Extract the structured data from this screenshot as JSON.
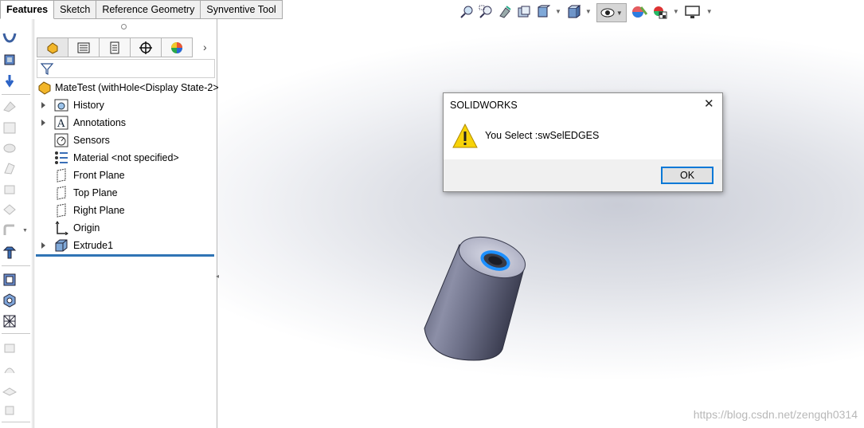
{
  "tabs": [
    "Features",
    "Sketch",
    "Reference Geometry",
    "Synventive Tool"
  ],
  "active_tab": "Features",
  "panel": {
    "tab_icons": [
      "feature-manager-icon",
      "property-manager-icon",
      "configuration-manager-icon",
      "dimxpert-icon",
      "display-manager-icon"
    ],
    "expand_arrow": "›",
    "root_label": "MateTest  (withHole<Display State-2>",
    "tree": [
      {
        "label": "History",
        "icon": "history-icon",
        "expandable": true
      },
      {
        "label": "Annotations",
        "icon": "annotations-icon",
        "expandable": true
      },
      {
        "label": "Sensors",
        "icon": "sensors-icon",
        "expandable": false
      },
      {
        "label": "Material <not specified>",
        "icon": "material-icon",
        "expandable": false
      },
      {
        "label": "Front Plane",
        "icon": "plane-icon",
        "expandable": false
      },
      {
        "label": "Top Plane",
        "icon": "plane-icon",
        "expandable": false
      },
      {
        "label": "Right Plane",
        "icon": "plane-icon",
        "expandable": false
      },
      {
        "label": "Origin",
        "icon": "origin-icon",
        "expandable": false
      },
      {
        "label": "Extrude1",
        "icon": "extrude-icon",
        "expandable": true
      }
    ]
  },
  "heads_up_toolbar": [
    "zoom-to-fit-icon",
    "zoom-to-area-icon",
    "previous-view-icon",
    "section-view-icon",
    "view-orientation-icon",
    "display-style-icon",
    "hide-show-items-icon",
    "edit-appearance-icon",
    "apply-scene-icon",
    "view-settings-icon"
  ],
  "dialog": {
    "title": "SOLIDWORKS",
    "close_glyph": "✕",
    "message": "You Select :swSelEDGES",
    "ok_label": "OK",
    "icon": "warning-icon"
  },
  "watermark": "https://blog.csdn.net/zengqh0314",
  "colors": {
    "selection_blue": "#2f74b5",
    "highlight_edge": "#1e90ff",
    "warning_yellow": "#f7d308"
  }
}
